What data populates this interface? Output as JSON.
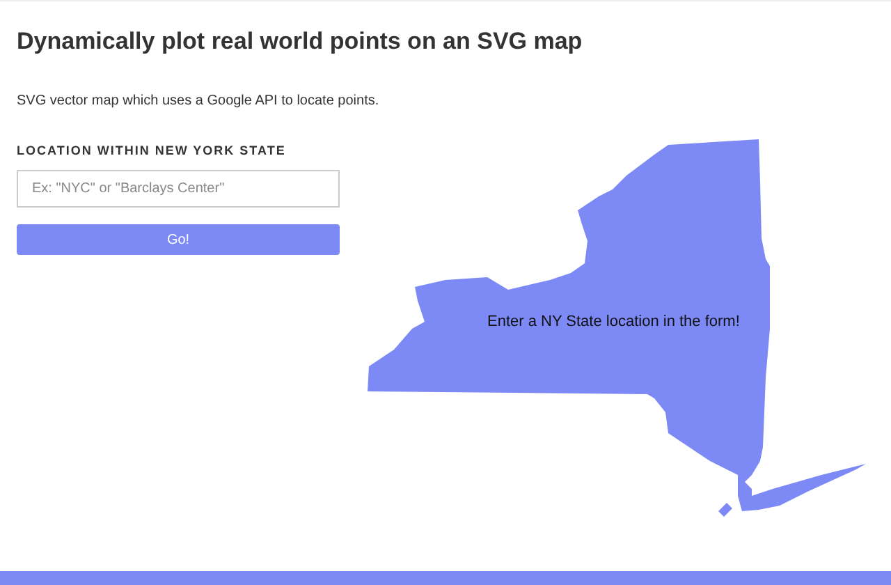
{
  "title": "Dynamically plot real world points on an SVG map",
  "description": "SVG vector map which uses a Google API to locate points.",
  "form": {
    "label": "LOCATION WITHIN NEW YORK STATE",
    "placeholder": "Ex: \"NYC\" or \"Barclays Center\"",
    "button": "Go!"
  },
  "map": {
    "message": "Enter a NY State location in the form!"
  }
}
